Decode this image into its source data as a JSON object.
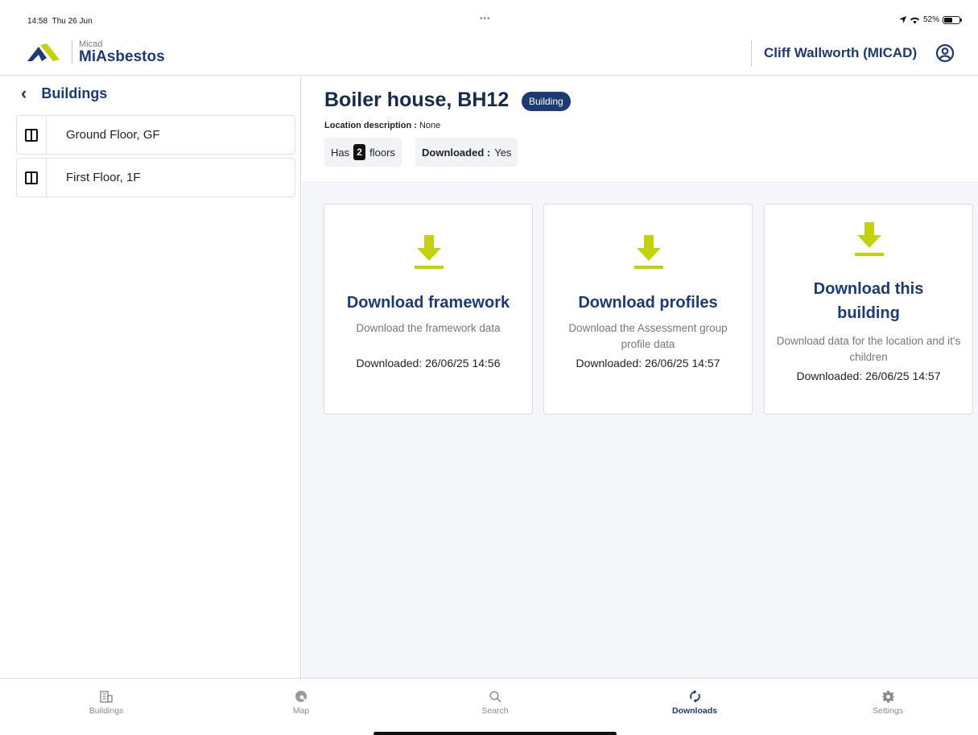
{
  "status_bar": {
    "time": "14:58",
    "date": "Thu 26 Jun",
    "dots": "•••",
    "battery": "52%"
  },
  "header": {
    "brand_small": "Micad",
    "brand_name": "MiAsbestos",
    "user_name": "Cliff Wallworth (MICAD)"
  },
  "sidebar": {
    "title": "Buildings",
    "items": [
      {
        "label": "Ground Floor, GF"
      },
      {
        "label": "First Floor, 1F"
      }
    ]
  },
  "building": {
    "title": "Boiler house, BH12",
    "badge": "Building",
    "location_label": "Location description :",
    "location_value": "None",
    "floors_prefix": "Has",
    "floors_count": "2",
    "floors_suffix": "floors",
    "downloaded_label": "Downloaded :",
    "downloaded_value": "Yes"
  },
  "cards": [
    {
      "title": "Download framework",
      "description": "Download the framework data",
      "downloaded": "Downloaded: 26/06/25 14:56"
    },
    {
      "title": "Download profiles",
      "description": "Download the Assessment group profile data",
      "downloaded": "Downloaded: 26/06/25 14:57"
    },
    {
      "title": "Download this building",
      "description": "Download data for the location and it's children",
      "downloaded": "Downloaded: 26/06/25 14:57"
    }
  ],
  "tabs": [
    {
      "label": "Buildings",
      "icon": "buildings-icon"
    },
    {
      "label": "Map",
      "icon": "map-icon"
    },
    {
      "label": "Search",
      "icon": "search-icon"
    },
    {
      "label": "Downloads",
      "icon": "sync-icon",
      "active": true
    },
    {
      "label": "Settings",
      "icon": "gear-icon"
    }
  ],
  "colors": {
    "brand_navy": "#1d3a73",
    "accent_lime": "#c3d20c",
    "background": "#f4f6f9"
  }
}
